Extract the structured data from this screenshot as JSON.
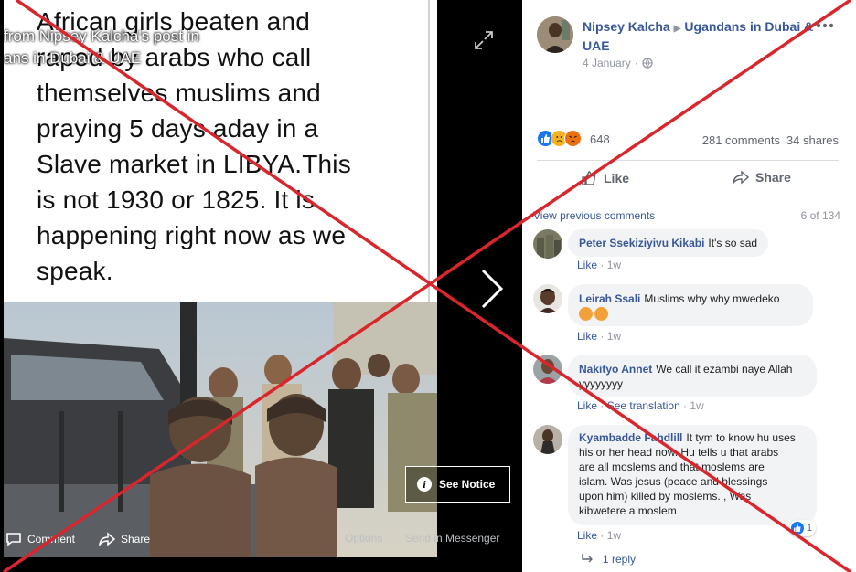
{
  "viewer": {
    "caption_lines": [
      "African girls beaten and",
      "raped by arabs who call",
      "themselves muslims and",
      "praying 5 days aday in a",
      "Slave market in LIBYA.This",
      "is not 1930 or 1825. It is",
      "happening right now as we",
      "speak."
    ],
    "overlay_caption": " from Nipsey Kalcha's post in\nans in Dubai & UAE",
    "see_notice_label": "See Notice",
    "footer": {
      "comment_label": "Comment",
      "share_label": "Share",
      "options_label": "Options",
      "messenger_label": "Send in Messenger"
    }
  },
  "post": {
    "author": "Nipsey Kalcha",
    "group": "Ugandans in Dubai &",
    "group_cont": "UAE",
    "date": "4 January",
    "privacy_icon": "globe-icon",
    "reactions": {
      "icons": [
        "like",
        "sad",
        "angry"
      ],
      "count": "648"
    },
    "comments_count": "281 comments",
    "shares_count": "34 shares",
    "like_label": "Like",
    "share_label": "Share"
  },
  "comments_section": {
    "view_previous": "View previous comments",
    "page_count": "6 of 134",
    "items": [
      {
        "name": "Peter Ssekiziyivu Kikabi",
        "text": "It's so sad",
        "like": "Like",
        "time": "1w"
      },
      {
        "name": "Leirah Ssali",
        "text": "Muslims why why mwedeko",
        "like": "Like",
        "time": "1w"
      },
      {
        "name": "Nakityo Annet",
        "text": "We call it ezambi naye Allah",
        "text2": "yyyyyyyy",
        "like": "Like",
        "see_translation": "See translation",
        "time": "1w"
      },
      {
        "name": "Kyambadde Fahdlill",
        "text": "It tym to know hu uses",
        "lines": [
          "his or her head now. Hu tells u that arabs",
          "are all moslems and that moslems are",
          "islam. Was jesus (peace and blessings",
          "upon him) killed by moslems. , Was",
          "kibwetere a moslem"
        ],
        "like": "Like",
        "time": "1w",
        "reaction_count": "1"
      }
    ],
    "reply_label": "1 reply"
  },
  "colors": {
    "link_blue": "#385898",
    "cross_red": "#d9262c",
    "bubble_bg": "#f2f3f5",
    "like_blue": "#1877f2"
  }
}
